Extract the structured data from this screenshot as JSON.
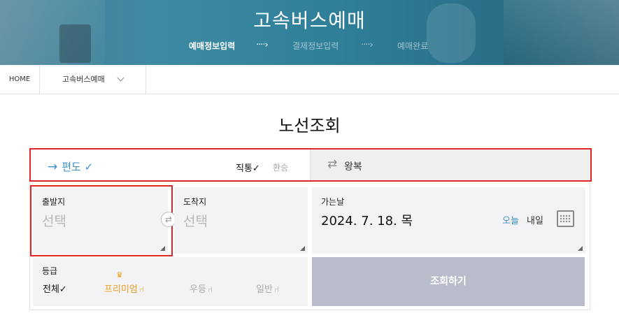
{
  "hero": {
    "title": "고속버스예매",
    "steps": [
      {
        "label": "예매정보입력",
        "active": true
      },
      {
        "label": "결제정보입력",
        "active": false
      },
      {
        "label": "예매완료",
        "active": false
      }
    ],
    "arrow": "····›"
  },
  "breadcrumb": {
    "home": "HOME",
    "current": "고속버스예매"
  },
  "page_title": "노선조회",
  "trip": {
    "oneway_label": "편도",
    "oneway_check": "✓",
    "direct_label": "직통",
    "direct_check": "✓",
    "transfer_label": "환승",
    "roundtrip_label": "왕복"
  },
  "departure": {
    "label": "출발지",
    "value": "선택"
  },
  "arrival": {
    "label": "도착지",
    "value": "선택"
  },
  "date": {
    "label": "가는날",
    "value": "2024. 7. 18. 목",
    "today": "오늘",
    "tomorrow": "내일"
  },
  "grade": {
    "label": "등급",
    "all": "전체",
    "all_check": "✓",
    "premium": "프리미엄",
    "excellent": "우등",
    "normal": "일반"
  },
  "search_button": "조회하기",
  "colors": {
    "accent_blue": "#3b8fc9",
    "premium_gold": "#e8a020",
    "highlight_red": "#e0252b",
    "button_gray": "#b9bdcb"
  }
}
